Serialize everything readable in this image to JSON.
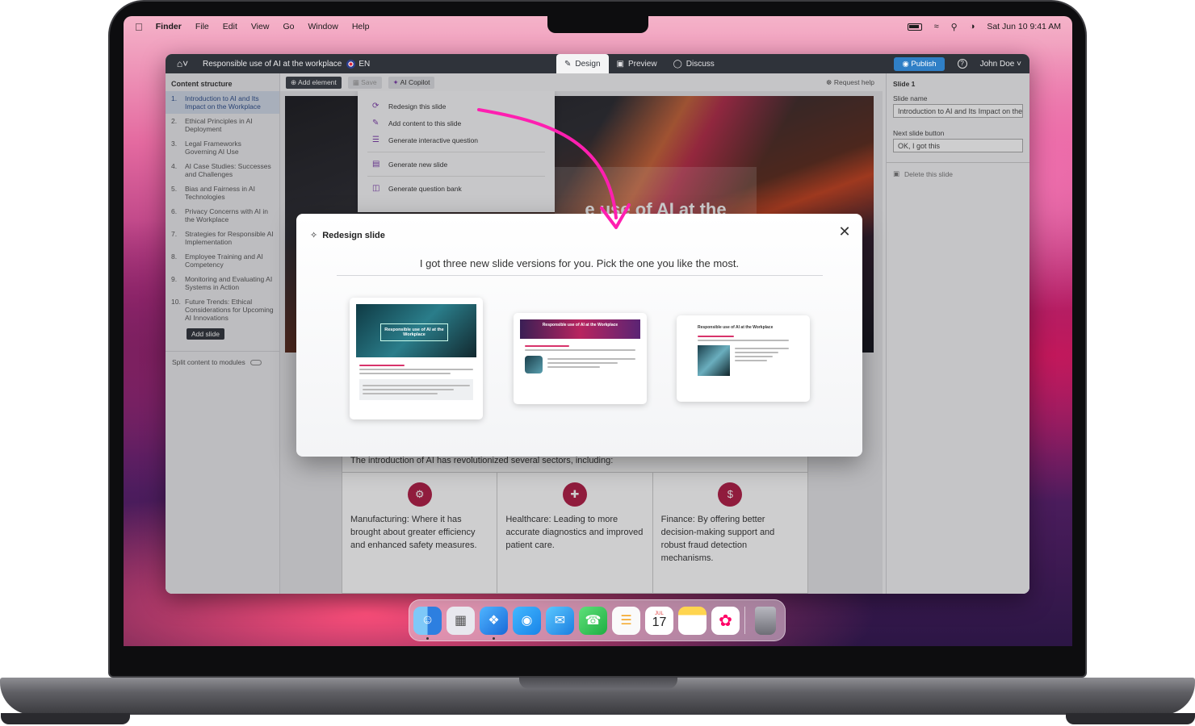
{
  "menubar": {
    "items": [
      "Finder",
      "File",
      "Edit",
      "View",
      "Go",
      "Window",
      "Help"
    ],
    "clock": "Sat Jun 10  9:41 AM"
  },
  "app": {
    "course_title": "Responsible use of AI at the workplace",
    "language": "EN",
    "tabs": [
      "Design",
      "Preview",
      "Discuss"
    ],
    "publish_label": "Publish",
    "help_symbol": "?",
    "user": "John Doe"
  },
  "left_panel": {
    "header": "Content structure",
    "slides": [
      {
        "num": "1.",
        "label": "Introduction to AI and Its Impact on the Workplace"
      },
      {
        "num": "2.",
        "label": "Ethical Principles in AI Deployment"
      },
      {
        "num": "3.",
        "label": "Legal Frameworks Governing AI Use"
      },
      {
        "num": "4.",
        "label": "AI Case Studies: Successes and Challenges"
      },
      {
        "num": "5.",
        "label": "Bias and Fairness in AI Technologies"
      },
      {
        "num": "6.",
        "label": "Privacy Concerns with AI in the Workplace"
      },
      {
        "num": "7.",
        "label": "Strategies for Responsible AI Implementation"
      },
      {
        "num": "8.",
        "label": "Employee Training and AI Competency"
      },
      {
        "num": "9.",
        "label": "Monitoring and Evaluating AI Systems in Action"
      },
      {
        "num": "10.",
        "label": "Future Trends: Ethical Considerations for Upcoming AI Innovations"
      }
    ],
    "add_slide_label": "Add slide",
    "split_label": "Split content to modules"
  },
  "toolbar": {
    "add_element": "Add element",
    "save": "Save",
    "ai_copilot": "AI Copilot",
    "request_help": "Request help"
  },
  "context_menu": {
    "items": [
      "Redesign this slide",
      "Add content to this slide",
      "Generate interactive question",
      "Generate new slide",
      "Generate question bank"
    ]
  },
  "slide": {
    "hero_title": "e use of AI at the",
    "intro": "The introduction of AI has revolutionized several sectors, including:",
    "columns": [
      "Manufacturing: Where it has brought about greater efficiency and enhanced safety measures.",
      "Healthcare: Leading to more accurate diagnostics and improved patient care.",
      "Finance: By offering better decision-making support and robust fraud detection mechanisms."
    ]
  },
  "right_panel": {
    "header": "Slide 1",
    "slide_name_label": "Slide name",
    "slide_name_value": "Introduction to AI and Its Impact on the Workplace",
    "next_button_label": "Next slide button",
    "next_button_value": "OK, I got this",
    "delete_label": "Delete this slide"
  },
  "modal": {
    "title": "Redesign slide",
    "message": "I got three new slide versions for you. Pick the one you like the most.",
    "version1_title": "Responsible use of AI at the Workplace",
    "version2_title": "Responsible use of AI at the Workplace",
    "version3_title": "Responsible use of AI at the Workplace"
  },
  "dock": {
    "calendar_month": "JUL",
    "calendar_day": "17"
  },
  "colors": {
    "accent": "#2f7fc6",
    "arrow": "#ff1fb0",
    "brand_red": "#b01c45"
  }
}
